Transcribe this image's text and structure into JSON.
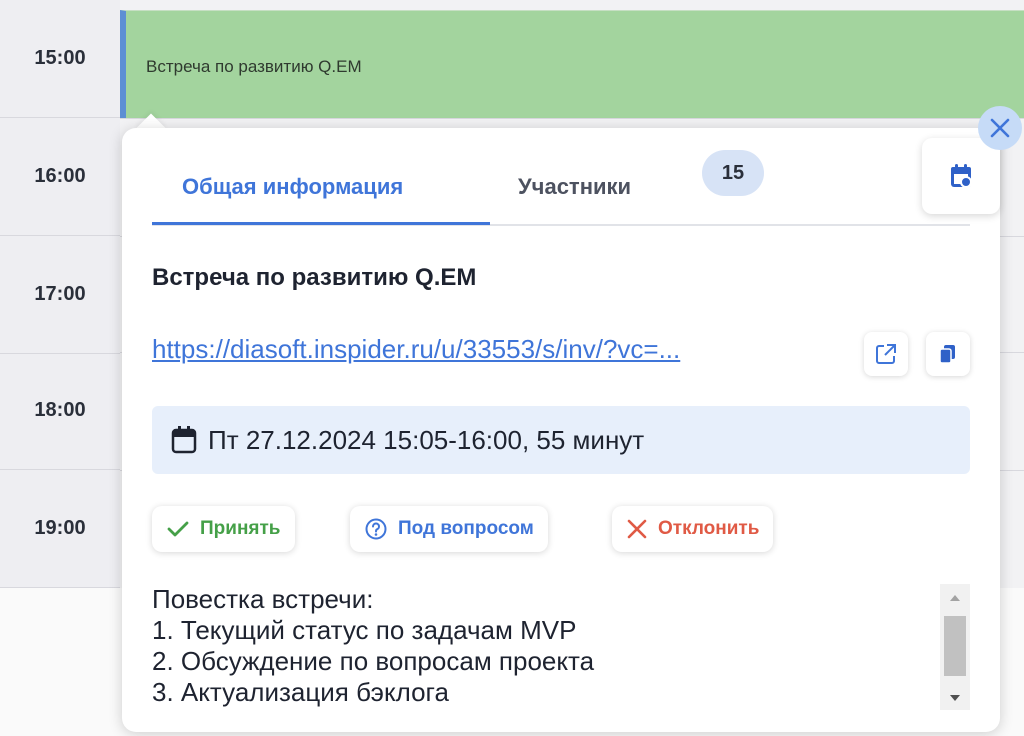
{
  "calendar": {
    "time_labels": [
      "15:00",
      "16:00",
      "17:00",
      "18:00",
      "19:00"
    ],
    "event_block_title": "Встреча по развитию Q.EM",
    "event_color": "#a3d49e",
    "accent_bar_color": "#5d8fd4"
  },
  "popup": {
    "close_icon": "close-icon",
    "tabs": [
      {
        "label": "Общая информация",
        "active": true
      },
      {
        "label": "Участники",
        "active": false,
        "badge": "15"
      }
    ],
    "calendar_button_icon": "calendar-icon",
    "title": "Встреча по развитию Q.EM",
    "link": {
      "text": "https://diasoft.inspider.ru/u/33553/s/inv/?vc=...",
      "open_icon": "external-link-icon",
      "copy_icon": "copy-icon"
    },
    "datetime": {
      "icon": "calendar-icon",
      "text": "Пт 27.12.2024 15:05-16:00, 55 минут"
    },
    "responses": {
      "accept": {
        "label": "Принять",
        "icon": "check-icon",
        "color": "#45a048"
      },
      "question": {
        "label": "Под вопросом",
        "icon": "question-circle-icon",
        "color": "#3f75d9"
      },
      "decline": {
        "label": "Отклонить",
        "icon": "x-icon",
        "color": "#e05a45"
      }
    },
    "agenda": [
      "Повестка встречи:",
      "1. Текущий статус по задачам MVP",
      "2. Обсуждение по вопросам проекта",
      "3. Актуализация бэклога"
    ]
  },
  "colors": {
    "primary": "#3f75d9",
    "date_bg": "#e7effb",
    "badge_bg": "#d7e3f6"
  }
}
